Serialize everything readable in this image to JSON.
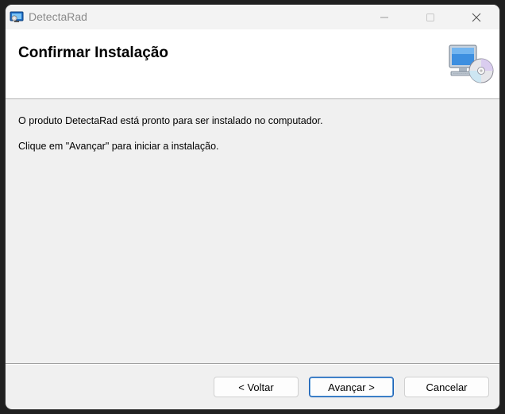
{
  "window": {
    "title": "DetectaRad"
  },
  "header": {
    "title": "Confirmar Instalação"
  },
  "body": {
    "line1": "O produto DetectaRad está pronto para ser instalado no computador.",
    "line2": "Clique em \"Avançar\" para iniciar a instalação."
  },
  "buttons": {
    "back_label": "< Voltar",
    "next_label": "Avançar >",
    "cancel_label": "Cancelar"
  },
  "icons": {
    "app": "installer-app-icon",
    "header": "computer-with-cd-icon",
    "minimize": "minimize-icon",
    "maximize": "maximize-icon",
    "close": "close-icon"
  },
  "colors": {
    "accent": "#1a5fb4",
    "background": "#f0f0f0",
    "header_background": "#ffffff"
  }
}
